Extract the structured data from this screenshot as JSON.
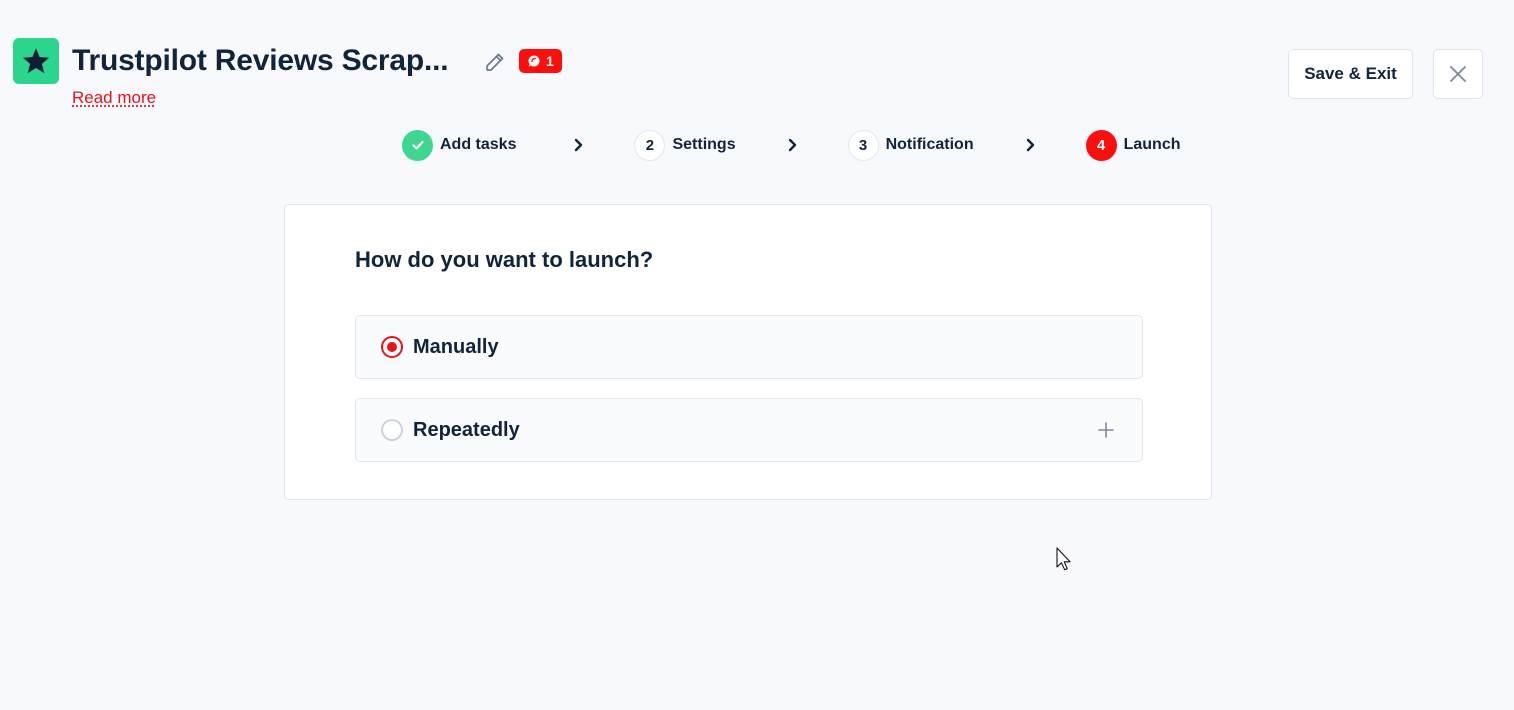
{
  "header": {
    "title": "Trustpilot Reviews Scrap...",
    "read_more": "Read more",
    "badge_count": "1",
    "save_exit_label": "Save & Exit"
  },
  "stepper": {
    "steps": [
      {
        "number": "",
        "label": "Add tasks",
        "state": "done"
      },
      {
        "number": "2",
        "label": "Settings",
        "state": "idle"
      },
      {
        "number": "3",
        "label": "Notification",
        "state": "idle"
      },
      {
        "number": "4",
        "label": "Launch",
        "state": "active"
      }
    ]
  },
  "launch": {
    "question": "How do you want to launch?",
    "options": [
      {
        "label": "Manually",
        "selected": true
      },
      {
        "label": "Repeatedly",
        "selected": false
      }
    ]
  },
  "colors": {
    "brand_green": "#2bd58e",
    "accent_red": "#ff0d0d",
    "text_dark": "#10243d",
    "background": "#f8f9fc"
  },
  "icons": {
    "logo": "star-icon",
    "edit": "pencil-icon",
    "badge": "comment-icon",
    "close": "close-icon",
    "step_done": "check-icon",
    "separator": "chevron-right-icon",
    "expand": "plus-icon"
  }
}
